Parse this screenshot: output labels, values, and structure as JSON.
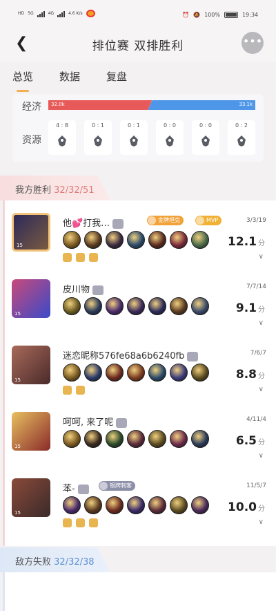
{
  "status_bar": {
    "left_labels": [
      "HD",
      "5G",
      "4G",
      "4.6 K/s"
    ],
    "battery": "100%",
    "time": "19:34"
  },
  "header": {
    "title": "排位赛 双排胜利"
  },
  "tabs": [
    "总览",
    "数据",
    "复盘"
  ],
  "overview": {
    "economy_label": "经济",
    "economy_left": "32.0k",
    "economy_right": "33.1k",
    "resources_label": "资源",
    "resources": [
      {
        "count": "4 : 8",
        "icon": "tyrant-icon"
      },
      {
        "count": "0 : 1",
        "icon": "dragon-icon"
      },
      {
        "count": "0 : 1",
        "icon": "dragon-icon"
      },
      {
        "count": "0 : 0",
        "icon": "overlord-icon"
      },
      {
        "count": "0 : 0",
        "icon": "lizard-icon"
      },
      {
        "count": "0 : 2",
        "icon": "storm-icon"
      }
    ]
  },
  "our_team": {
    "label": "我方胜利",
    "stats": "32/32/51",
    "players": [
      {
        "name": "他💕打我…",
        "level": "15",
        "kda": "3/3/19",
        "score": "12.1",
        "score_unit": "分",
        "badges": [
          {
            "text": "金牌坦克",
            "color": "#f1a33a"
          },
          {
            "text": "MVP",
            "color": "#f0b135"
          }
        ],
        "avatar_bg": "linear-gradient(135deg,#2c2a5a,#7a5a40)",
        "items": [
          "#7a5a20",
          "#5a3a20",
          "#3a2a40",
          "#2a4a6a",
          "#5a2a20",
          "#7a2a3a",
          "#4a6a4a"
        ],
        "skills": 3
      },
      {
        "name": "皮川物",
        "level": "15",
        "kda": "7/7/14",
        "score": "9.1",
        "score_unit": "分",
        "badges": [],
        "avatar_bg": "linear-gradient(135deg,#c84a7a,#3a4ac8)",
        "items": [
          "#6a5a20",
          "#2a3a5a",
          "#4a2a6a",
          "#3a2a5a",
          "#2a2a5a",
          "#5a3a20",
          "#3a4a6a"
        ],
        "skills": 0
      },
      {
        "name": "迷恋昵称576fe68a6b6240fb",
        "level": "15",
        "kda": "7/6/7",
        "score": "8.8",
        "score_unit": "分",
        "badges": [],
        "avatar_bg": "linear-gradient(135deg,#a86a5a,#4a2a2a)",
        "items": [
          "#7a5a20",
          "#2a3a6a",
          "#6a2a20",
          "#7a3a20",
          "#2a4a6a",
          "#3a3a7a",
          "#5a4a20"
        ],
        "skills": 2
      },
      {
        "name": "呵呵, 来了呢",
        "level": "15",
        "kda": "4/11/4",
        "score": "6.5",
        "score_unit": "分",
        "badges": [],
        "avatar_bg": "linear-gradient(135deg,#e8c060,#8a2a2a)",
        "items": [
          "#7a5a20",
          "#3a2a20",
          "#2a4a2a",
          "#5a2a3a",
          "#5a4a20",
          "#6a2a4a",
          "#2a3a5a"
        ],
        "skills": 0
      },
      {
        "name": "苯-",
        "level": "15",
        "kda": "11/5/7",
        "score": "10.0",
        "score_unit": "分",
        "badges": [
          {
            "text": "银牌刺客",
            "color": "#8c8fa8"
          }
        ],
        "avatar_bg": "linear-gradient(135deg,#8a4a3a,#3a2a2a)",
        "items": [
          "#4a2a6a",
          "#5a3a20",
          "#6a2a20",
          "#3a2a6a",
          "#5a2a3a",
          "#5a4a20",
          "#4a2a5a"
        ],
        "skills": 3
      }
    ]
  },
  "enemy_team": {
    "label": "敌方失败",
    "stats": "32/32/38"
  },
  "colors": {
    "accent": "#f0b050",
    "win_red": "#e85a5a",
    "lose_blue": "#4d96e8",
    "stats_red": "#e07a7a",
    "stats_blue": "#5a8fd0"
  }
}
